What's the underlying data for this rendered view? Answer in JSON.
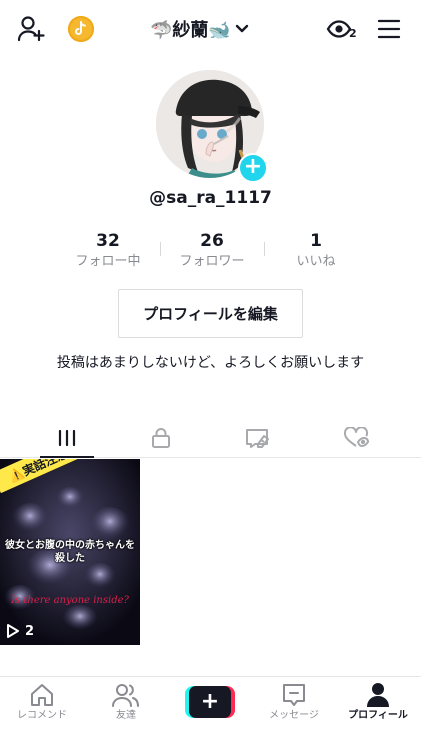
{
  "header": {
    "display_name": "🦈紗蘭🐋",
    "viewer_count": "2"
  },
  "profile": {
    "username": "@sa_ra_1117",
    "stats": [
      {
        "value": "32",
        "label": "フォロー中"
      },
      {
        "value": "26",
        "label": "フォロワー"
      },
      {
        "value": "1",
        "label": "いいね"
      }
    ],
    "edit_label": "プロフィールを編集",
    "bio": "投稿はあまりしないけど、よろしくお願いします"
  },
  "tabs": {
    "icons": [
      "grid-icon",
      "lock-icon",
      "tagged-icon",
      "liked-icon"
    ],
    "active": 0
  },
  "videos": [
    {
      "badge": "⚠️実話注意⚠️",
      "caption": "彼女とお腹の中の赤ちゃんを殺した",
      "overlay_text": "Is there anyone inside?",
      "views": "2"
    }
  ],
  "bottom_nav": [
    {
      "label": "レコメンド",
      "icon": "home-icon"
    },
    {
      "label": "友達",
      "icon": "friends-icon"
    },
    {
      "label": "",
      "icon": "create-icon"
    },
    {
      "label": "メッセージ",
      "icon": "inbox-icon"
    },
    {
      "label": "プロフィール",
      "icon": "profile-icon"
    }
  ],
  "colors": {
    "accent_cyan": "#20d5ec",
    "create_red": "#fe2c55",
    "create_cyan": "#25f4ee",
    "text_primary": "#161823",
    "text_secondary": "#8a8b91"
  }
}
